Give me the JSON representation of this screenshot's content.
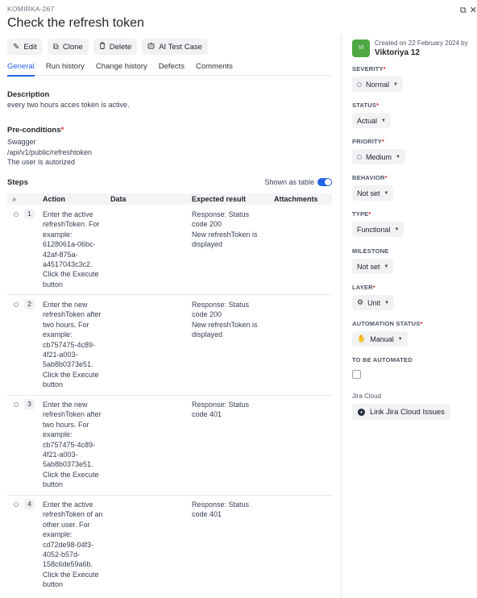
{
  "header": {
    "case_key": "KOMIRKA-267",
    "title": "Check the refresh token"
  },
  "toolbar": {
    "edit": "Edit",
    "clone": "Clone",
    "delete": "Delete",
    "ai_test_case": "AI Test Case"
  },
  "tabs": [
    "General",
    "Run history",
    "Change history",
    "Defects",
    "Comments"
  ],
  "description": {
    "label": "Description",
    "text": "every two hours acces token is active."
  },
  "preconditions": {
    "label": "Pre-conditions",
    "lines": [
      "Swagger",
      "/api/v1/public/refreshtoken",
      "The user is autorized"
    ]
  },
  "steps": {
    "label": "Steps",
    "shown_as_table": "Shown as table",
    "columns": {
      "action": "Action",
      "data": "Data",
      "expected": "Expected result",
      "attachments": "Attachments"
    },
    "rows": [
      {
        "num": "1",
        "action": [
          "Enter the active",
          "refreshToken. For",
          "example:",
          "6128061a-06bc-",
          "42af-875a-",
          "a4517043c3c2.",
          "Click the Execute",
          "button"
        ],
        "expected": [
          "Response: Status",
          "code 200",
          "New refreshToken is",
          "displayed"
        ]
      },
      {
        "num": "2",
        "action": [
          "Enter the new",
          "refreshToken after",
          "two hours. For",
          "example:",
          "cb757475-4c89-",
          "4f21-a003-",
          "5ab8b0373e51.",
          "Click the Execute",
          "button"
        ],
        "expected": [
          "Response: Status",
          "code 200",
          "New refreshToken is",
          "displayed"
        ]
      },
      {
        "num": "3",
        "action": [
          "Enter the new",
          "refreshToken after",
          "two hours. For",
          "example:",
          "cb757475-4c89-",
          "4f21-a003-",
          "5ab8b0373e51.",
          "Click the Execute",
          "button"
        ],
        "expected": [
          "Response: Status",
          "code 401"
        ]
      },
      {
        "num": "4",
        "action": [
          "Enter the active",
          "refreshToken of an",
          "other user. For",
          "example:",
          "cd72de98-04f3-",
          "4052-b57d-",
          "158c6de59a6b.",
          "Click the Execute",
          "button"
        ],
        "expected": [
          "Response: Status",
          "code 401"
        ]
      }
    ]
  },
  "sidebar": {
    "avatar_initials": "VI",
    "created_on": "Created on 22 February 2024 by",
    "creator": "Viktoriya 12",
    "fields": {
      "severity": {
        "label": "SEVERITY",
        "value": "Normal"
      },
      "status": {
        "label": "STATUS",
        "value": "Actual"
      },
      "priority": {
        "label": "PRIORITY",
        "value": "Medium"
      },
      "behavior": {
        "label": "BEHAVIOR",
        "value": "Not set"
      },
      "type": {
        "label": "TYPE",
        "value": "Functional"
      },
      "milestone": {
        "label": "MILESTONE",
        "value": "Not set"
      },
      "layer": {
        "label": "LAYER",
        "value": "Unit"
      },
      "automation_status": {
        "label": "AUTOMATION STATUS",
        "value": "Manual"
      },
      "to_be_automated": {
        "label": "TO BE AUTOMATED"
      }
    },
    "jira": {
      "label": "Jira Cloud",
      "button": "Link Jira Cloud Issues"
    }
  },
  "colors": {
    "accent": "#2563eb",
    "required": "#dc2626",
    "avatar": "#4ea843"
  }
}
